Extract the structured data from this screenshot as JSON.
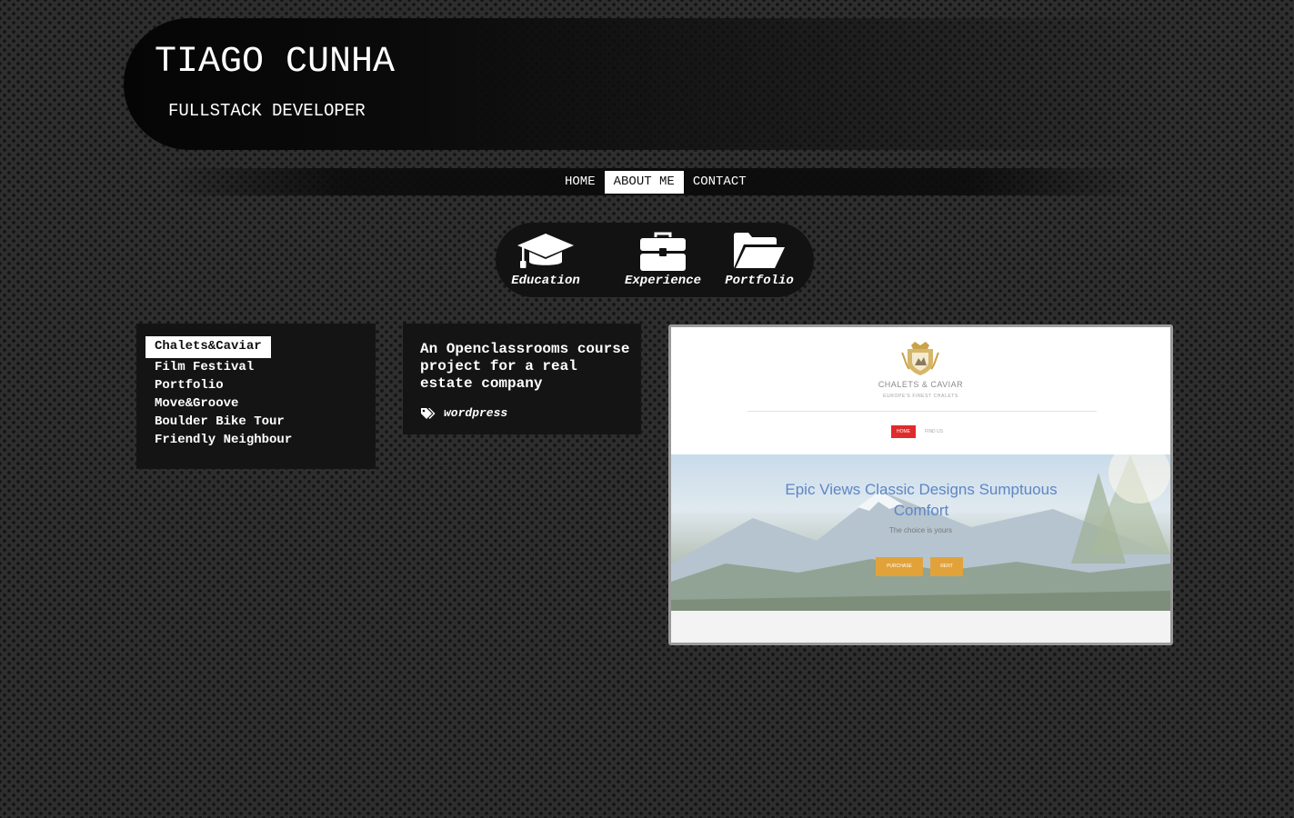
{
  "header": {
    "title": "TIAGO CUNHA",
    "subtitle": "FULLSTACK DEVELOPER"
  },
  "nav": {
    "items": [
      {
        "label": "HOME",
        "active": false
      },
      {
        "label": "ABOUT ME",
        "active": true
      },
      {
        "label": "CONTACT",
        "active": false
      }
    ]
  },
  "tabs": [
    {
      "label": "Education",
      "icon": "graduation-cap-icon"
    },
    {
      "label": "Experience",
      "icon": "briefcase-icon"
    },
    {
      "label": "Portfolio",
      "icon": "folder-open-icon"
    }
  ],
  "projects": {
    "items": [
      {
        "label": "Chalets&Caviar",
        "active": true
      },
      {
        "label": "Film Festival",
        "active": false
      },
      {
        "label": "Portfolio",
        "active": false
      },
      {
        "label": "Move&Groove",
        "active": false
      },
      {
        "label": "Boulder Bike Tour",
        "active": false
      },
      {
        "label": "Friendly Neighbour",
        "active": false
      }
    ]
  },
  "project_detail": {
    "description": "An Openclassrooms course project for a real estate company",
    "tag_icon": "tags-icon",
    "tags": "wordpress"
  },
  "preview": {
    "brand": "CHALETS & CAVIAR",
    "tagline": "EUROPE'S FINEST CHALETS",
    "nav_home": "HOME",
    "nav_find": "FIND US",
    "hero_title": "Epic Views Classic Designs Sumptuous Comfort",
    "hero_subtitle": "The choice is yours",
    "button_purchase": "PURCHASE",
    "button_rent": "RENT"
  },
  "colors": {
    "background": "#2e2e2e",
    "panel": "#141414",
    "active_bg": "#ffffff",
    "preview_accent": "#e02b2b",
    "preview_button": "#e2a23a",
    "preview_heading": "#5d86c4"
  }
}
